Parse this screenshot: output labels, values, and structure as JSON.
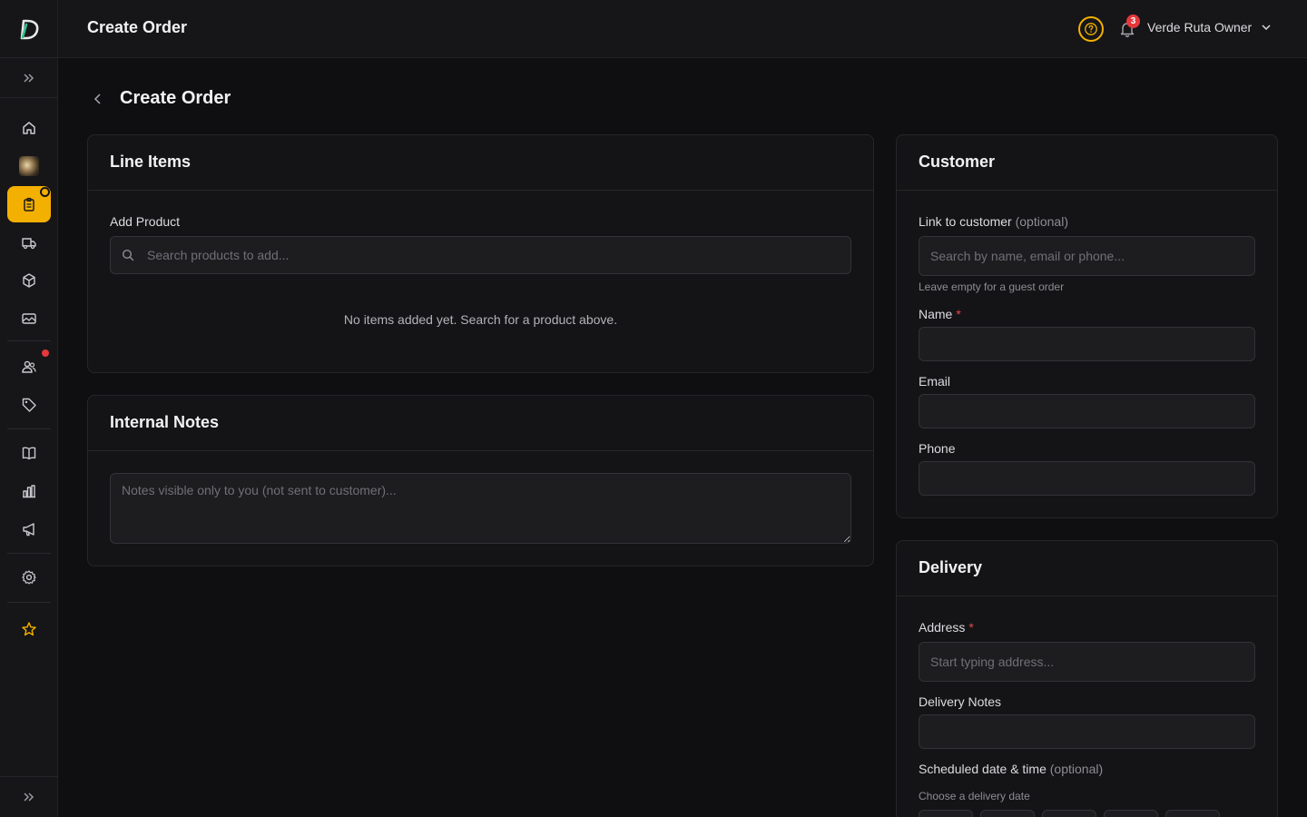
{
  "app": {
    "title": "Create Order"
  },
  "topbar": {
    "user_name": "Verde Ruta Owner",
    "notification_count": "3"
  },
  "page": {
    "title": "Create Order"
  },
  "line_items": {
    "title": "Line Items",
    "add_product_label": "Add Product",
    "search_placeholder": "Search products to add...",
    "empty_message": "No items added yet. Search for a product above."
  },
  "internal_notes": {
    "title": "Internal Notes",
    "placeholder": "Notes visible only to you (not sent to customer)..."
  },
  "customer": {
    "title": "Customer",
    "link_label": "Link to customer",
    "link_optional": "(optional)",
    "link_placeholder": "Search by name, email or phone...",
    "link_hint": "Leave empty for a guest order",
    "name_label": "Name",
    "required_mark": "*",
    "email_label": "Email",
    "phone_label": "Phone"
  },
  "delivery": {
    "title": "Delivery",
    "address_label": "Address",
    "address_placeholder": "Start typing address...",
    "notes_label": "Delivery Notes",
    "scheduled_label": "Scheduled date & time",
    "scheduled_optional": "(optional)",
    "scheduled_hint": "Choose a delivery date"
  },
  "sidebar": {
    "items": [
      {
        "icon": "home-icon"
      },
      {
        "icon": "store-avatar"
      },
      {
        "icon": "orders-icon",
        "active": true
      },
      {
        "icon": "truck-icon"
      },
      {
        "icon": "box-icon"
      },
      {
        "icon": "image-icon"
      },
      {
        "icon": "users-icon"
      },
      {
        "icon": "tag-icon"
      },
      {
        "icon": "book-icon"
      },
      {
        "icon": "chart-icon"
      },
      {
        "icon": "megaphone-icon"
      },
      {
        "icon": "settings-icon"
      },
      {
        "icon": "star-icon"
      }
    ]
  },
  "colors": {
    "accent": "#f4b000",
    "badge": "#e5383b",
    "background": "#0f0f11"
  }
}
